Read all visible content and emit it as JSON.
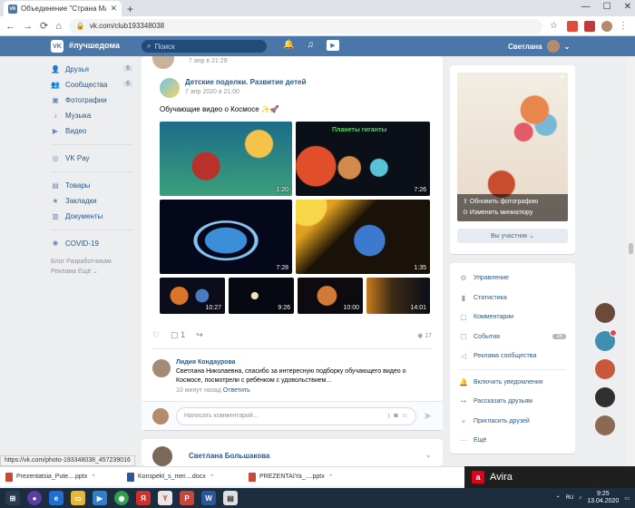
{
  "browser": {
    "tab_title": "Объединение \"Страна Мастер...",
    "url": "vk.com/club193348038"
  },
  "header": {
    "logo": "VK",
    "tagline": "#лучшедома",
    "search_placeholder": "Поиск",
    "user_name": "Светлана"
  },
  "sidebar": {
    "items": [
      {
        "label": "Друзья",
        "count": "6"
      },
      {
        "label": "Сообщества",
        "count": "6"
      },
      {
        "label": "Фотографии",
        "count": ""
      },
      {
        "label": "Музыка",
        "count": ""
      },
      {
        "label": "Видео",
        "count": ""
      },
      {
        "label": "VK Pay",
        "count": ""
      },
      {
        "label": "Товары",
        "count": ""
      },
      {
        "label": "Закладки",
        "count": ""
      },
      {
        "label": "Документы",
        "count": ""
      },
      {
        "label": "COVID-19",
        "count": ""
      }
    ],
    "footer_line1": "Блог   Разработчикам",
    "footer_line2": "Реклама   Ещё ⌄"
  },
  "post": {
    "prev_date": "7 апр в 21:29",
    "author": "Детские поделки. Развитие детей",
    "date": "7 апр 2020 в 21:00",
    "text": "Обучающие видео о Космосе ✨🚀",
    "videos": [
      {
        "duration": "1:20",
        "label": ""
      },
      {
        "duration": "7:26",
        "label": "Планеты гиганты"
      },
      {
        "duration": "7:28",
        "label": ""
      },
      {
        "duration": "1:35",
        "label": ""
      },
      {
        "duration": "10:27",
        "label": ""
      },
      {
        "duration": "9:26",
        "label": ""
      },
      {
        "duration": "10:00",
        "label": ""
      },
      {
        "duration": "14:01",
        "label": ""
      }
    ],
    "comments_count": "1",
    "views": "17"
  },
  "comment": {
    "author": "Лидия Кондаурова",
    "text": "Светлана Николаевна, спасибо за интересную подборку обучающего видео о Космосе, посмотрели с ребёнком с удовольствием...",
    "time": "10 минут назад",
    "reply_label": "Ответить"
  },
  "reply_box": {
    "placeholder": "Написать комментарий..."
  },
  "next_post": {
    "author": "Светлана Большакова"
  },
  "cover": {
    "update_photo": "Обновить фотографию",
    "change_thumb": "Изменить миниатюру",
    "join_button": "Вы участник ⌄"
  },
  "management": {
    "items": [
      {
        "label": "Управление",
        "icon": "gear-icon"
      },
      {
        "label": "Статистика",
        "icon": "stats-icon"
      },
      {
        "label": "Комментарии",
        "icon": "comment-icon"
      },
      {
        "label": "События",
        "icon": "events-icon",
        "badge": "16"
      },
      {
        "label": "Реклама сообщества",
        "icon": "megaphone-icon"
      },
      {
        "label": "Включить уведомления",
        "icon": "bell-icon"
      },
      {
        "label": "Рассказать друзьям",
        "icon": "share-icon"
      },
      {
        "label": "Пригласить друзей",
        "icon": "invite-icon"
      },
      {
        "label": "Ещё",
        "icon": "more-icon"
      }
    ]
  },
  "status_url": "https://vk.com/photo-193348038_457239016",
  "downloads": [
    {
      "name": "Prezentatsia_Pute....pptx"
    },
    {
      "name": "Konspekt_s_mer....docx"
    },
    {
      "name": "PREZENTAIYa_....pptx"
    }
  ],
  "avira": {
    "name": "Avira"
  },
  "taskbar": {
    "time": "9:25",
    "date": "13.04.2020",
    "lang": "RU"
  }
}
